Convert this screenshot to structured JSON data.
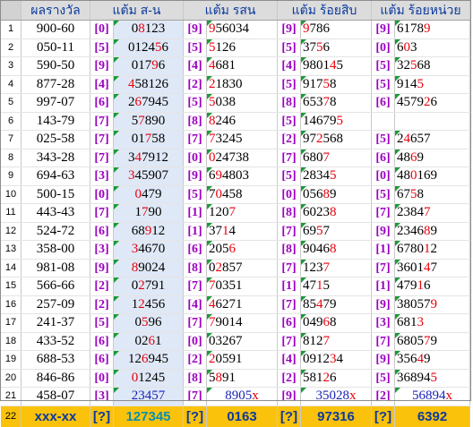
{
  "headers": [
    "ผลรางวัล",
    "แต้ม ส-น",
    "แต้ม รสน",
    "แต้ม ร้อยสิบ",
    "แต้ม ร้อยหน่วย"
  ],
  "rows": [
    {
      "no": "1",
      "res": "900-60",
      "b1": "[0]",
      "d1": [
        [
          "",
          "0"
        ],
        [
          "r",
          "8"
        ],
        [
          "",
          "123"
        ]
      ],
      "b2": "[9]",
      "d2": [
        [
          "r",
          "9"
        ],
        [
          "",
          "56034"
        ]
      ],
      "b3": "[9]",
      "d3": [
        [
          "r",
          "9"
        ],
        [
          "",
          "786"
        ]
      ],
      "b4": "[9]",
      "d4": [
        [
          "",
          "6178"
        ],
        [
          "r",
          "9"
        ]
      ]
    },
    {
      "no": "2",
      "res": "050-11",
      "b1": "[5]",
      "d1": [
        [
          "",
          "0124"
        ],
        [
          "r",
          "5"
        ],
        [
          "",
          "6"
        ]
      ],
      "b2": "[5]",
      "d2": [
        [
          "r",
          "5"
        ],
        [
          "",
          "126"
        ]
      ],
      "b3": "[5]",
      "d3": [
        [
          "",
          "37"
        ],
        [
          "r",
          "5"
        ],
        [
          "",
          "6"
        ]
      ],
      "b4": "[0]",
      "d4": [
        [
          "",
          "6"
        ],
        [
          "r",
          "0"
        ],
        [
          "",
          "3"
        ]
      ]
    },
    {
      "no": "3",
      "res": "590-50",
      "b1": "[9]",
      "d1": [
        [
          "",
          "017"
        ],
        [
          "r",
          "9"
        ],
        [
          "",
          "6"
        ]
      ],
      "b2": "[4]",
      "d2": [
        [
          "r",
          "4"
        ],
        [
          "",
          "681"
        ]
      ],
      "b3": "[4]",
      "d3": [
        [
          "",
          "9801"
        ],
        [
          "r",
          "4"
        ],
        [
          "",
          "5"
        ]
      ],
      "b4": "[5]",
      "d4": [
        [
          "",
          "32"
        ],
        [
          "r",
          "5"
        ],
        [
          "",
          "68"
        ]
      ]
    },
    {
      "no": "4",
      "res": "877-28",
      "b1": "[4]",
      "d1": [
        [
          "r",
          "4"
        ],
        [
          "",
          "58126"
        ]
      ],
      "b2": "[2]",
      "d2": [
        [
          "r",
          "2"
        ],
        [
          "",
          "1830"
        ]
      ],
      "b3": "[5]",
      "d3": [
        [
          "",
          "917"
        ],
        [
          "r",
          "5"
        ],
        [
          "",
          "8"
        ]
      ],
      "b4": "[5]",
      "d4": [
        [
          "",
          "914"
        ],
        [
          "r",
          "5"
        ]
      ]
    },
    {
      "no": "5",
      "res": "997-07",
      "b1": "[6]",
      "d1": [
        [
          "",
          "2"
        ],
        [
          "r",
          "6"
        ],
        [
          "",
          "7945"
        ]
      ],
      "b2": "[5]",
      "d2": [
        [
          "r",
          "5"
        ],
        [
          "",
          "038"
        ]
      ],
      "b3": "[8]",
      "d3": [
        [
          "",
          "653"
        ],
        [
          "r",
          "7"
        ],
        [
          "",
          "8"
        ]
      ],
      "b4": "[6]",
      "d4": [
        [
          "",
          "4579"
        ],
        [
          "r",
          "2"
        ],
        [
          "",
          "6"
        ]
      ]
    },
    {
      "no": "6",
      "res": "143-79",
      "b1": "[7]",
      "d1": [
        [
          "",
          "5"
        ],
        [
          "r",
          "7"
        ],
        [
          "",
          "890"
        ]
      ],
      "b2": "[8]",
      "d2": [
        [
          "r",
          "8"
        ],
        [
          "",
          "246"
        ]
      ],
      "b3": "[5]",
      "d3": [
        [
          "",
          "14679"
        ],
        [
          "r",
          "5"
        ]
      ]
    },
    {
      "no": "7",
      "res": "025-58",
      "b1": "[7]",
      "d1": [
        [
          "",
          "01"
        ],
        [
          "r",
          "7"
        ],
        [
          "",
          "58"
        ]
      ],
      "b2": "[7]",
      "d2": [
        [
          "r",
          "7"
        ],
        [
          "",
          "3245"
        ]
      ],
      "b3": "[2]",
      "d3": [
        [
          "",
          "97"
        ],
        [
          "r",
          "2"
        ],
        [
          "",
          "568"
        ]
      ],
      "b4": "[5]",
      "d4": [
        [
          "",
          "2"
        ],
        [
          "r",
          "4"
        ],
        [
          "",
          "657"
        ]
      ]
    },
    {
      "no": "8",
      "res": "343-28",
      "b1": "[7]",
      "d1": [
        [
          "",
          "3"
        ],
        [
          "r",
          "4"
        ],
        [
          "",
          "7912"
        ]
      ],
      "b2": "[0]",
      "d2": [
        [
          "r",
          "0"
        ],
        [
          "",
          "24738"
        ]
      ],
      "b3": "[7]",
      "d3": [
        [
          "",
          "680"
        ],
        [
          "r",
          "7"
        ]
      ],
      "b4": "[6]",
      "d4": [
        [
          "",
          "48"
        ],
        [
          "r",
          "6"
        ],
        [
          "",
          "9"
        ]
      ]
    },
    {
      "no": "9",
      "res": "694-63",
      "b1": "[3]",
      "d1": [
        [
          "r",
          "3"
        ],
        [
          "",
          "45907"
        ]
      ],
      "b2": "[9]",
      "d2": [
        [
          "",
          "6"
        ],
        [
          "r",
          "9"
        ],
        [
          "",
          "4803"
        ]
      ],
      "b3": "[5]",
      "d3": [
        [
          "",
          "2834"
        ],
        [
          "r",
          "5"
        ]
      ],
      "b4": "[0]",
      "d4": [
        [
          "",
          "48"
        ],
        [
          "r",
          "0"
        ],
        [
          "",
          "169"
        ]
      ]
    },
    {
      "no": "10",
      "res": "500-15",
      "b1": "[0]",
      "d1": [
        [
          "r",
          "0"
        ],
        [
          "",
          "479"
        ]
      ],
      "b2": "[5]",
      "d2": [
        [
          "",
          "7"
        ],
        [
          "r",
          "0"
        ],
        [
          "",
          "458"
        ]
      ],
      "b3": "[0]",
      "d3": [
        [
          "",
          "056"
        ],
        [
          "r",
          "8"
        ],
        [
          "",
          "9"
        ]
      ],
      "b4": "[5]",
      "d4": [
        [
          "",
          "67"
        ],
        [
          "r",
          "5"
        ],
        [
          "",
          "8"
        ]
      ]
    },
    {
      "no": "11",
      "res": "443-43",
      "b1": "[7]",
      "d1": [
        [
          "",
          "1"
        ],
        [
          "r",
          "7"
        ],
        [
          "",
          "90"
        ]
      ],
      "b2": "[1]",
      "d2": [
        [
          "",
          "120"
        ],
        [
          "r",
          "7"
        ]
      ],
      "b3": "[8]",
      "d3": [
        [
          "",
          "6023"
        ],
        [
          "r",
          "8"
        ]
      ],
      "b4": "[7]",
      "d4": [
        [
          "",
          "2384"
        ],
        [
          "r",
          "7"
        ]
      ]
    },
    {
      "no": "12",
      "res": "524-72",
      "b1": "[6]",
      "d1": [
        [
          "",
          "68"
        ],
        [
          "r",
          "9"
        ],
        [
          "",
          "12"
        ]
      ],
      "b2": "[1]",
      "d2": [
        [
          "",
          "37"
        ],
        [
          "r",
          "1"
        ],
        [
          "",
          "4"
        ]
      ],
      "b3": "[7]",
      "d3": [
        [
          "",
          "69"
        ],
        [
          "r",
          "5"
        ],
        [
          "",
          "7"
        ]
      ],
      "b4": "[9]",
      "d4": [
        [
          "",
          "2346"
        ],
        [
          "r",
          "8"
        ],
        [
          "",
          "9"
        ]
      ]
    },
    {
      "no": "13",
      "res": "358-00",
      "b1": "[3]",
      "d1": [
        [
          "r",
          "3"
        ],
        [
          "",
          "4670"
        ]
      ],
      "b2": "[6]",
      "d2": [
        [
          "",
          "205"
        ],
        [
          "r",
          "6"
        ]
      ],
      "b3": "[8]",
      "d3": [
        [
          "",
          "9046"
        ],
        [
          "r",
          "8"
        ]
      ],
      "b4": "[1]",
      "d4": [
        [
          "",
          "6780"
        ],
        [
          "r",
          "1"
        ],
        [
          "",
          "2"
        ]
      ]
    },
    {
      "no": "14",
      "res": "981-08",
      "b1": "[9]",
      "d1": [
        [
          "r",
          "8"
        ],
        [
          "",
          "9024"
        ]
      ],
      "b2": "[8]",
      "d2": [
        [
          "",
          "0"
        ],
        [
          "r",
          "2"
        ],
        [
          "",
          "857"
        ]
      ],
      "b3": "[7]",
      "d3": [
        [
          "",
          "123"
        ],
        [
          "r",
          "7"
        ]
      ],
      "b4": "[7]",
      "d4": [
        [
          "",
          "3601"
        ],
        [
          "r",
          "4"
        ],
        [
          "",
          "7"
        ]
      ]
    },
    {
      "no": "15",
      "res": "566-66",
      "b1": "[2]",
      "d1": [
        [
          "",
          "0"
        ],
        [
          "r",
          "2"
        ],
        [
          "",
          "791"
        ]
      ],
      "b2": "[7]",
      "d2": [
        [
          "r",
          "7"
        ],
        [
          "",
          "0351"
        ]
      ],
      "b3": "[1]",
      "d3": [
        [
          "",
          "47"
        ],
        [
          "r",
          "1"
        ],
        [
          "",
          "5"
        ]
      ],
      "b4": "[1]",
      "d4": [
        [
          "",
          "479"
        ],
        [
          "r",
          "1"
        ],
        [
          "",
          "6"
        ]
      ]
    },
    {
      "no": "16",
      "res": "257-09",
      "b1": "[2]",
      "d1": [
        [
          "",
          "1"
        ],
        [
          "r",
          "2"
        ],
        [
          "",
          "456"
        ]
      ],
      "b2": "[4]",
      "d2": [
        [
          "r",
          "4"
        ],
        [
          "",
          "6271"
        ]
      ],
      "b3": "[7]",
      "d3": [
        [
          "",
          "85"
        ],
        [
          "r",
          "4"
        ],
        [
          "",
          "79"
        ]
      ],
      "b4": "[9]",
      "d4": [
        [
          "",
          "38057"
        ],
        [
          "r",
          "9"
        ]
      ]
    },
    {
      "no": "17",
      "res": "241-37",
      "b1": "[5]",
      "d1": [
        [
          "",
          "0"
        ],
        [
          "r",
          "5"
        ],
        [
          "",
          "96"
        ]
      ],
      "b2": "[7]",
      "d2": [
        [
          "r",
          "7"
        ],
        [
          "",
          "9014"
        ]
      ],
      "b3": "[6]",
      "d3": [
        [
          "",
          "049"
        ],
        [
          "r",
          "6"
        ],
        [
          "",
          "8"
        ]
      ],
      "b4": "[3]",
      "d4": [
        [
          "",
          "681"
        ],
        [
          "r",
          "3"
        ]
      ]
    },
    {
      "no": "18",
      "res": "433-52",
      "b1": "[6]",
      "d1": [
        [
          "",
          "02"
        ],
        [
          "r",
          "6"
        ],
        [
          "",
          "1"
        ]
      ],
      "b2": "[0]",
      "d2": [
        [
          "",
          "03267"
        ]
      ],
      "b3": "[7]",
      "d3": [
        [
          "",
          "812"
        ],
        [
          "r",
          "7"
        ]
      ],
      "b4": "[7]",
      "d4": [
        [
          "",
          "6805"
        ],
        [
          "r",
          "7"
        ],
        [
          "",
          "9"
        ]
      ]
    },
    {
      "no": "19",
      "res": "688-53",
      "b1": "[6]",
      "d1": [
        [
          "",
          "12"
        ],
        [
          "r",
          "6"
        ],
        [
          "",
          "945"
        ]
      ],
      "b2": "[2]",
      "d2": [
        [
          "r",
          "2"
        ],
        [
          "",
          "0591"
        ]
      ],
      "b3": "[4]",
      "d3": [
        [
          "",
          "0912"
        ],
        [
          "r",
          "3"
        ],
        [
          "",
          "4"
        ]
      ],
      "b4": "[9]",
      "d4": [
        [
          "",
          "356"
        ],
        [
          "r",
          "4"
        ],
        [
          "",
          "9"
        ]
      ]
    },
    {
      "no": "20",
      "res": "846-86",
      "b1": "[0]",
      "d1": [
        [
          "r",
          "0"
        ],
        [
          "",
          "1245"
        ]
      ],
      "b2": "[8]",
      "d2": [
        [
          "",
          "5"
        ],
        [
          "r",
          "8"
        ],
        [
          "",
          "91"
        ]
      ],
      "b3": "[2]",
      "d3": [
        [
          "",
          "581"
        ],
        [
          "r",
          "2"
        ],
        [
          "",
          "6"
        ]
      ],
      "b4": "[5]",
      "d4": [
        [
          "",
          "36894"
        ],
        [
          "r",
          "5"
        ]
      ]
    }
  ],
  "row21": {
    "no": "21",
    "res": "458-07",
    "b1": "[3]",
    "d1": "23457",
    "b2": "[7]",
    "d2": "8905",
    "d2x": "x",
    "b3": "[9]",
    "d3": "35028",
    "d3x": "x",
    "b4": "[2]",
    "d4": "56894",
    "d4x": "x"
  },
  "row22": {
    "no": "22",
    "res": "xxx-xx",
    "b1": "[?]",
    "d1": "127345",
    "b2": "[?]",
    "d2": "0163",
    "b3": "[?]",
    "d3": "97316",
    "b4": "[?]",
    "d4": "6392"
  }
}
